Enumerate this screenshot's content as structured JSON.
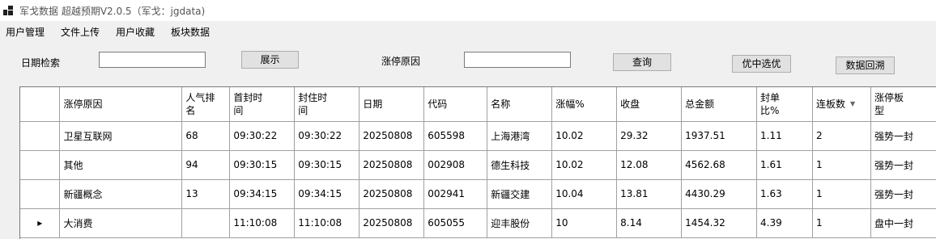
{
  "window": {
    "title": "军戈数据 超越预期V2.0.5（军戈：jgdata)",
    "icon": "grid-icon"
  },
  "menu": {
    "items": [
      "用户管理",
      "文件上传",
      "用户收藏",
      "板块数据"
    ]
  },
  "search": {
    "date_label": "日期检索",
    "date_value": "",
    "show_button": "展示",
    "reason_label": "涨停原因",
    "reason_value": "",
    "query_button": "查询",
    "select_button": "优中选优",
    "backtrack_button": "数据回溯"
  },
  "grid": {
    "columns": [
      "涨停原因",
      "人气排名",
      "首封时间",
      "封住时间",
      "日期",
      "代码",
      "名称",
      "涨幅%",
      "收盘",
      "总金额",
      "封单比%",
      "连板数",
      "涨停板型"
    ],
    "sort_column": "连板数",
    "current_row_marker": "▸",
    "rows": [
      {
        "reason": "卫星互联网",
        "rank": "68",
        "first_seal": "09:30:22",
        "seal_time": "09:30:22",
        "date": "20250808",
        "code": "605598",
        "name": "上海港湾",
        "change": "10.02",
        "close": "29.32",
        "amount": "1937.51",
        "seal_ratio": "1.11",
        "boards": "2",
        "type": "强势一封"
      },
      {
        "reason": "其他",
        "rank": "94",
        "first_seal": "09:30:15",
        "seal_time": "09:30:15",
        "date": "20250808",
        "code": "002908",
        "name": "德生科技",
        "change": "10.02",
        "close": "12.08",
        "amount": "4562.68",
        "seal_ratio": "1.61",
        "boards": "1",
        "type": "强势一封"
      },
      {
        "reason": "新疆概念",
        "rank": "13",
        "first_seal": "09:34:15",
        "seal_time": "09:34:15",
        "date": "20250808",
        "code": "002941",
        "name": "新疆交建",
        "change": "10.04",
        "close": "13.81",
        "amount": "4430.29",
        "seal_ratio": "1.63",
        "boards": "1",
        "type": "强势一封"
      },
      {
        "reason": "大消费",
        "rank": "",
        "first_seal": "11:10:08",
        "seal_time": "11:10:08",
        "date": "20250808",
        "code": "605055",
        "name": "迎丰股份",
        "change": "10",
        "close": "8.14",
        "amount": "1454.32",
        "seal_ratio": "4.39",
        "boards": "1",
        "type": "盘中一封"
      }
    ]
  }
}
